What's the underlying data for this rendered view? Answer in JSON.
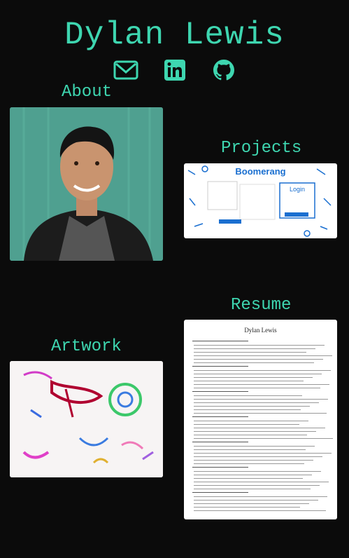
{
  "header": {
    "name": "Dylan Lewis"
  },
  "social": [
    {
      "icon": "email-icon"
    },
    {
      "icon": "linkedin-icon"
    },
    {
      "icon": "github-icon"
    }
  ],
  "sections": {
    "about": "About",
    "projects": "Projects",
    "resume": "Resume",
    "artwork": "Artwork"
  },
  "projects_preview": {
    "app_name": "Boomerang",
    "login_label": "Login"
  },
  "resume_preview": {
    "name": "Dylan Lewis"
  },
  "colors": {
    "accent": "#3ed6b0",
    "background": "#0b0b0b"
  }
}
